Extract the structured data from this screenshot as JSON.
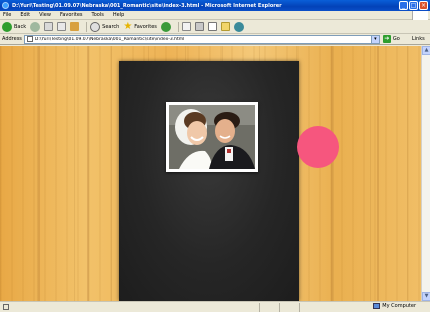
{
  "window": {
    "title": "D:\\Yuri\\Testing\\01.09.07\\Nebraska\\001_Romantic\\site\\index-3.html - Microsoft Internet Explorer",
    "min": "_",
    "max": "□",
    "close": "×"
  },
  "menu": [
    "File",
    "Edit",
    "View",
    "Favorites",
    "Tools",
    "Help"
  ],
  "toolbar": {
    "back": "Back",
    "search": "Search",
    "favorites": "Favorites"
  },
  "address": {
    "label": "Address",
    "url": "D:\\Yuri\\Testing\\01.09.07\\Nebraska\\001_Romantic\\site\\index-3.html",
    "go": "Go",
    "links": "Links"
  },
  "status": {
    "zone": "My Computer"
  },
  "colors": {
    "accent_circle": "#f6567e",
    "panel": "#262626",
    "wood": "#eeb356"
  }
}
